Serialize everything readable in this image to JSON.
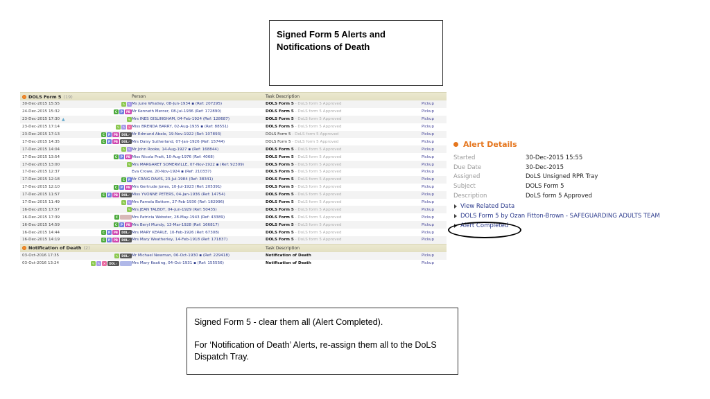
{
  "callouts": {
    "top_title": "Signed Form 5 Alerts and Notifications of Death",
    "bottom_line1": "Signed Form 5 - clear them all (Alert Completed).",
    "bottom_line2": "For ‘Notification of Death’ Alerts, re-assign them all to the DoLS Dispatch Tray."
  },
  "sections": [
    {
      "name": "DOLS Form 5",
      "count": "(19)",
      "col_person": "Person",
      "col_task": "Task Description",
      "rows": [
        {
          "date": "30-Dec-2015 15:55",
          "badges": [
            "edit",
            "note"
          ],
          "person": "Ms June Whatley, 08-Jun-1934 ▪ (Ref: 207295)",
          "task": "DOLS Form 5",
          "sub": " - DoLS form 5 Approved",
          "bold": true,
          "action": "Pickup"
        },
        {
          "date": "24-Dec-2015 15:32",
          "badges": [
            "c",
            "p",
            "pb"
          ],
          "person": "Mr Kenneth Mercer, 08-Jul-1936 (Ref: 172890)",
          "task": "DOLS Form 5",
          "sub": " - DoLS form 5 Approved",
          "bold": true,
          "action": "Pickup"
        },
        {
          "date": "23-Dec-2015 17:30",
          "warn": true,
          "badges": [
            "edit"
          ],
          "person": "Mrs INES GISLINGHAM, 04-Feb-1924 (Ref: 128687)",
          "task": "DOLS Form 5",
          "sub": " - DoLS form 5 Approved",
          "bold": true,
          "action": "Pickup"
        },
        {
          "date": "23-Dec-2015 17:14",
          "badges": [
            "edit",
            "note",
            "red"
          ],
          "person": "Miss BRENDA BARRY, 02-Aug-1935 ▪ (Ref: 88551)",
          "task": "DOLS Form 5",
          "sub": " - DoLS form 5 Approved",
          "bold": true,
          "action": "Pickup"
        },
        {
          "date": "23-Dec-2015 17:13",
          "badges": [
            "c",
            "p",
            "pb",
            "dol"
          ],
          "person": "Mr Edmund Abele, 19-Nov-1922 (Ref: 107893)",
          "task": "DOLS Form 5",
          "sub": " - DoLS form 5 Approved",
          "bold": false,
          "action": "Pickup"
        },
        {
          "date": "17-Dec-2015 14:35",
          "badges": [
            "c",
            "p",
            "pb",
            "dol"
          ],
          "person": "Mrs Daisy Sutherland, 07-Jan-1926 (Ref: 15744)",
          "task": "DOLS Form 5",
          "sub": " - DoLS form 5 Approved",
          "bold": false,
          "action": "Pickup"
        },
        {
          "date": "17-Dec-2015 14:04",
          "badges": [
            "edit",
            "note"
          ],
          "person": "Mr John Rooke, 14-Aug-1927 ▪ (Ref: 168844)",
          "task": "DOLS Form 5",
          "sub": " - DoLS form 5 Approved",
          "bold": true,
          "action": "Pickup"
        },
        {
          "date": "17-Dec-2015 13:54",
          "badges": [
            "c",
            "p",
            "pb"
          ],
          "person": "Miss Nicola Pratt, 10-Aug-1976 (Ref: 4068)",
          "task": "DOLS Form 5",
          "sub": " - DoLS form 5 Approved",
          "bold": true,
          "action": "Pickup"
        },
        {
          "date": "17-Dec-2015 13:00",
          "badges": [
            "edit"
          ],
          "person": "Mrs MARGARET SOMERVILLE, 07-Nov-1922 ▪ (Ref: 92309)",
          "task": "DOLS Form 5",
          "sub": " - DoLS form 5 Approved",
          "bold": true,
          "action": "Pickup"
        },
        {
          "date": "17-Dec-2015 12:37",
          "badges": [],
          "person": "Eva Crowe, 20-Nov-1924 ▪ (Ref: 210337)",
          "task": "DOLS Form 5",
          "sub": " - DoLS form 5 Approved",
          "bold": true,
          "action": "Pickup"
        },
        {
          "date": "17-Dec-2015 12:18",
          "badges": [
            "c",
            "p"
          ],
          "person": "Mr CRAIG DAVIS, 23-Jul-1984 (Ref: 38341)",
          "task": "DOLS Form 5",
          "sub": " - DoLS form 5 Approved",
          "bold": true,
          "action": "Pickup"
        },
        {
          "date": "17-Dec-2015 12:10",
          "badges": [
            "c",
            "p",
            "pb"
          ],
          "person": "Mrs Gertrude Jones, 10-Jul-1923 (Ref: 205391)",
          "task": "DOLS Form 5",
          "sub": " - DoLS form 5 Approved",
          "bold": true,
          "action": "Pickup"
        },
        {
          "date": "17-Dec-2015 11:57",
          "badges": [
            "c",
            "p",
            "pb",
            "dol"
          ],
          "person": "Miss YVONNE PETERS, 04-Jan-1936 (Ref: 14754)",
          "task": "DOLS Form 5",
          "sub": " - DoLS form 5 Approved",
          "bold": true,
          "action": "Pickup"
        },
        {
          "date": "17-Dec-2015 11:49",
          "badges": [
            "edit",
            "note"
          ],
          "person": "Mrs Pamela Bottom, 27-Feb-1930 (Ref: 182996)",
          "task": "DOLS Form 5",
          "sub": " - DoLS form 5 Approved",
          "bold": true,
          "action": "Pickup"
        },
        {
          "date": "16-Dec-2015 17:57",
          "badges": [
            "edit"
          ],
          "person": "Mrs JEAN TALBOT, 04-Jun-1929 (Ref: 50435)",
          "task": "DOLS Form 5",
          "sub": " - DoLS form 5 Approved",
          "bold": true,
          "action": "Pickup"
        },
        {
          "date": "16-Dec-2015 17:39",
          "badges": [
            "c",
            "gr"
          ],
          "person": "Mrs Patricia Webster, 28-May-1943 (Ref: 43389)",
          "task": "DOLS Form 5",
          "sub": " - DoLS form 5 Approved",
          "bold": true,
          "action": "Pickup"
        },
        {
          "date": "16-Dec-2015 14:59",
          "badges": [
            "c",
            "p",
            "pb"
          ],
          "person": "Mrs Beryl Mundy, 13-Mar-1928 (Ref: 166817)",
          "task": "DOLS Form 5",
          "sub": " - DoLS form 5 Approved",
          "bold": true,
          "action": "Pickup"
        },
        {
          "date": "16-Dec-2015 14:44",
          "badges": [
            "c",
            "p",
            "pb",
            "dol"
          ],
          "person": "Mrs MARY KEARLE, 10-Feb-1926 (Ref: 67308)",
          "task": "DOLS Form 5",
          "sub": " - DoLS form 5 Approved",
          "bold": true,
          "action": "Pickup"
        },
        {
          "date": "16-Dec-2015 14:19",
          "badges": [
            "c",
            "p",
            "pb",
            "dol"
          ],
          "person": "Mrs Mary Weatherley, 14-Feb-1918 (Ref: 171837)",
          "task": "DOLS Form 5",
          "sub": " - DoLS form 5 Approved",
          "bold": true,
          "action": "Pickup"
        }
      ]
    },
    {
      "name": "Notification of Death",
      "count": "(2)",
      "col_person": "",
      "col_task": "Task Description",
      "rows": [
        {
          "date": "03-Oct-2016 17:35",
          "badges": [
            "edit",
            "dol"
          ],
          "person": "Mr Michael Newman, 06-Oct-1930 ▪ (Ref: 229418)",
          "task": "Notification of Death",
          "sub": "",
          "bold": true,
          "action": "Pickup"
        },
        {
          "date": "03-Oct-2016 13:24",
          "badges": [
            "edit",
            "note",
            "red",
            "dol",
            "ext"
          ],
          "person": "Mrs Mary Keating, 04-Oct-1931 ▪ (Ref: 155556)",
          "task": "Notification of Death",
          "sub": "",
          "bold": true,
          "action": "Pickup"
        }
      ]
    }
  ],
  "badge_labels": {
    "c": "C",
    "p": "P",
    "pb": "PB",
    "dol": "DOL✓",
    "edit": "✎",
    "note": "✎",
    "red": "✕",
    "ext": "",
    "gr": ""
  },
  "alert_details": {
    "title": "Alert Details",
    "fields": [
      {
        "label": "Started",
        "value": "30-Dec-2015 15:55"
      },
      {
        "label": "Due Date",
        "value": "30-Dec-2015"
      },
      {
        "label": "Assigned",
        "value": "DoLS Unsigned RPR Tray"
      },
      {
        "label": "Subject",
        "value": "DOLS Form 5"
      },
      {
        "label": "Description",
        "value": "DoLS form 5 Approved"
      }
    ],
    "links": [
      "View Related Data",
      "DOLS Form 5 by Ozan Fitton-Brown - SAFEGUARDING ADULTS TEAM",
      "Alert Completed"
    ]
  },
  "colors": {
    "accent": "#e5761e",
    "link": "#2b3a8c",
    "section_header": "#e8e5c8"
  }
}
